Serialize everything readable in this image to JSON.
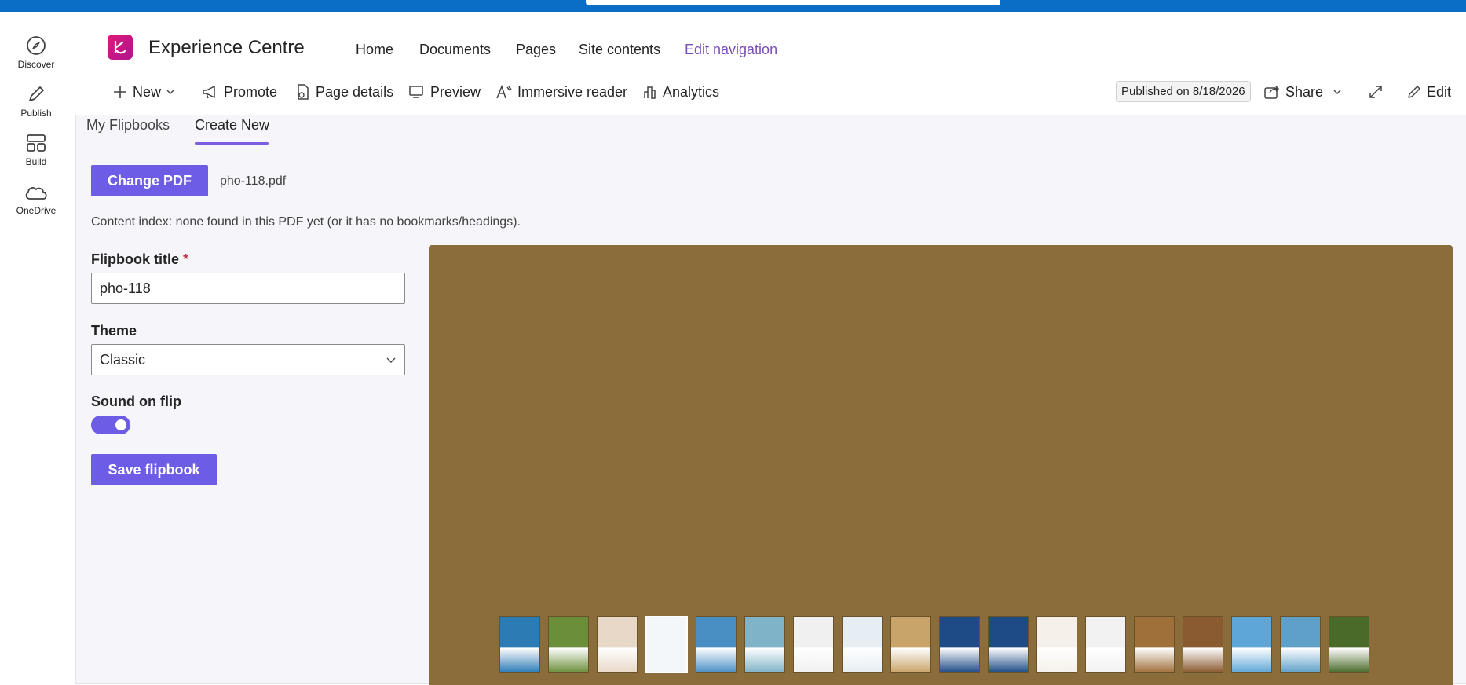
{
  "rail": {
    "items": [
      {
        "label": "Discover",
        "icon": "compass-icon"
      },
      {
        "label": "Publish",
        "icon": "pen-icon"
      },
      {
        "label": "Build",
        "icon": "layout-icon"
      },
      {
        "label": "OneDrive",
        "icon": "cloud-icon"
      }
    ]
  },
  "site": {
    "title": "Experience Centre",
    "nav": [
      "Home",
      "Documents",
      "Pages",
      "Site contents",
      "Edit navigation"
    ]
  },
  "commandbar": {
    "new": "New",
    "promote": "Promote",
    "page_details": "Page details",
    "preview": "Preview",
    "immersive_reader": "Immersive reader",
    "analytics": "Analytics",
    "published": "Published on 8/18/2026",
    "share": "Share",
    "edit": "Edit"
  },
  "tabs": [
    "My Flipbooks",
    "Create New"
  ],
  "form": {
    "change_pdf": "Change PDF",
    "filename": "pho-118.pdf",
    "content_index": "Content index: none found in this PDF yet (or it has no bookmarks/headings).",
    "title_label": "Flipbook title",
    "required_marker": "*",
    "title_value": "pho-118",
    "theme_label": "Theme",
    "theme_value": "Classic",
    "sound_label": "Sound on flip",
    "sound_on": true,
    "save": "Save flipbook"
  },
  "colors": {
    "accent": "#6d5ce6",
    "viewer_bg": "#8a6d3b",
    "topbar": "#0a6ec7"
  },
  "thumbnails": {
    "count": 18,
    "selected_index": 3,
    "colors": [
      "#2d7bb5",
      "#6b8e3a",
      "#e8d8c8",
      "#ffffff",
      "#4a8fc4",
      "#7fb3c8",
      "#f0f0f0",
      "#e6eef3",
      "#c9a46a",
      "#1e4b86",
      "#1e4b86",
      "#f5f0ea",
      "#f2f2f2",
      "#a0703a",
      "#8a5a30",
      "#5fa6d8",
      "#5fa0c8",
      "#4a6a2a"
    ]
  }
}
